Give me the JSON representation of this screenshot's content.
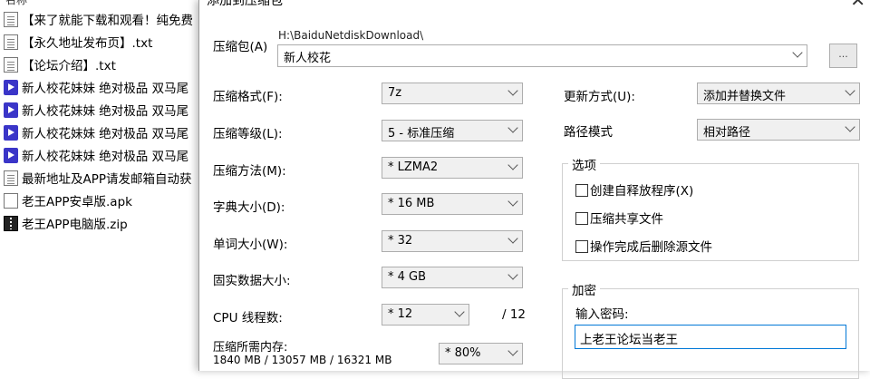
{
  "filelist": {
    "header": "名称",
    "items": [
      {
        "icon": "txt-file-icon",
        "name": "【来了就能下载和观看！纯免费"
      },
      {
        "icon": "txt-file-icon",
        "name": "【永久地址发布页】.txt"
      },
      {
        "icon": "txt-file-icon",
        "name": "【论坛介绍】.txt"
      },
      {
        "icon": "video-file-icon",
        "name": "新人校花妹妹 绝对极品 双马尾"
      },
      {
        "icon": "video-file-icon",
        "name": "新人校花妹妹 绝对极品 双马尾"
      },
      {
        "icon": "video-file-icon",
        "name": "新人校花妹妹 绝对极品 双马尾"
      },
      {
        "icon": "video-file-icon",
        "name": "新人校花妹妹 绝对极品 双马尾"
      },
      {
        "icon": "txt-file-icon",
        "name": "最新地址及APP请发邮箱自动获"
      },
      {
        "icon": "apk-file-icon",
        "name": "老王APP安卓版.apk"
      },
      {
        "icon": "zip-file-icon",
        "name": "老王APP电脑版.zip"
      }
    ]
  },
  "dialog": {
    "title": "添加到压缩包",
    "close": "✕",
    "archive_label": "压缩包(A)",
    "archive_path": "H:\\BaiduNetdiskDownload\\",
    "archive_name": "新人校花",
    "browse_label": "...",
    "left_options": [
      {
        "label": "压缩格式(F):",
        "value": "7z"
      },
      {
        "label": "压缩等级(L):",
        "value": "5 - 标准压缩"
      },
      {
        "label": "压缩方法(M):",
        "value": "* LZMA2"
      },
      {
        "label": "字典大小(D):",
        "value": "* 16 MB"
      },
      {
        "label": "单词大小(W):",
        "value": "* 32"
      },
      {
        "label": "固实数据大小:",
        "value": "* 4 GB"
      },
      {
        "label": "CPU 线程数:",
        "value": "* 12",
        "suffix": "/ 12"
      }
    ],
    "memory_label": "压缩所需内存:",
    "memory_value": "1840 MB / 13057 MB / 16321 MB",
    "memory_percent": "* 80%",
    "update_label": "更新方式(U):",
    "update_value": "添加并替换文件",
    "path_mode_label": "路径模式",
    "path_mode_value": "相对路径",
    "options_title": "选项",
    "options": [
      "创建自释放程序(X)",
      "压缩共享文件",
      "操作完成后删除源文件"
    ],
    "encrypt_title": "加密",
    "password_label": "输入密码:",
    "password_value": "上老王论坛当老王"
  }
}
